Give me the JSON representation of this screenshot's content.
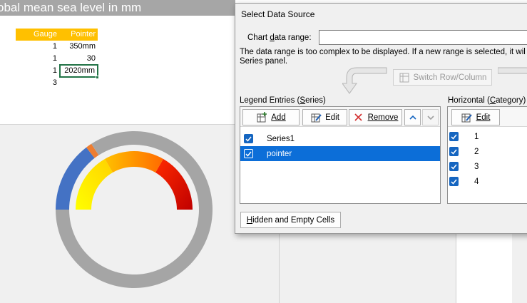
{
  "sheet": {
    "title": "obal mean sea level in mm",
    "table_headers": [
      "Gauge",
      "Pointer"
    ],
    "rows": [
      {
        "gauge": "1",
        "pointer": "350mm"
      },
      {
        "gauge": "1",
        "pointer": "30"
      },
      {
        "gauge": "1",
        "pointer": "2020mm"
      },
      {
        "gauge": "3",
        "pointer": ""
      }
    ],
    "header_color": "#ffc000"
  },
  "chart_data": {
    "type": "pie",
    "series": [
      {
        "name": "Series1",
        "values": [
          1,
          1,
          1,
          3
        ],
        "colors": [
          "gradient-yellow",
          "gradient-orange",
          "gradient-red",
          "#a6a6a6"
        ]
      },
      {
        "name": "pointer",
        "values": [
          350,
          30,
          2020
        ],
        "colors": [
          "#4472c4",
          "#ed7d31",
          "#a5a5a5"
        ]
      }
    ],
    "categories": [
      "1",
      "2",
      "3",
      "4"
    ]
  },
  "dialog": {
    "title": "Select Data Source",
    "chart_range_label": "Chart data range:",
    "chart_range_value": "",
    "message_line1": "The data range is too complex to be displayed. If a new range is selected, it wil",
    "message_line2": "Series panel.",
    "switch_label": "Switch Row/Column",
    "legend_title": "Legend Entries (Series)",
    "add_label": "Add",
    "edit_label": "Edit",
    "remove_label": "Remove",
    "series_items": [
      {
        "label": "Series1",
        "checked": true,
        "selected": false
      },
      {
        "label": "pointer",
        "checked": true,
        "selected": true
      }
    ],
    "horizontal_title": "Horizontal (Category)",
    "category_edit_label": "Edit",
    "category_items": [
      "1",
      "2",
      "3",
      "4"
    ],
    "hidden_cells_label": "Hidden and Empty Cells"
  }
}
